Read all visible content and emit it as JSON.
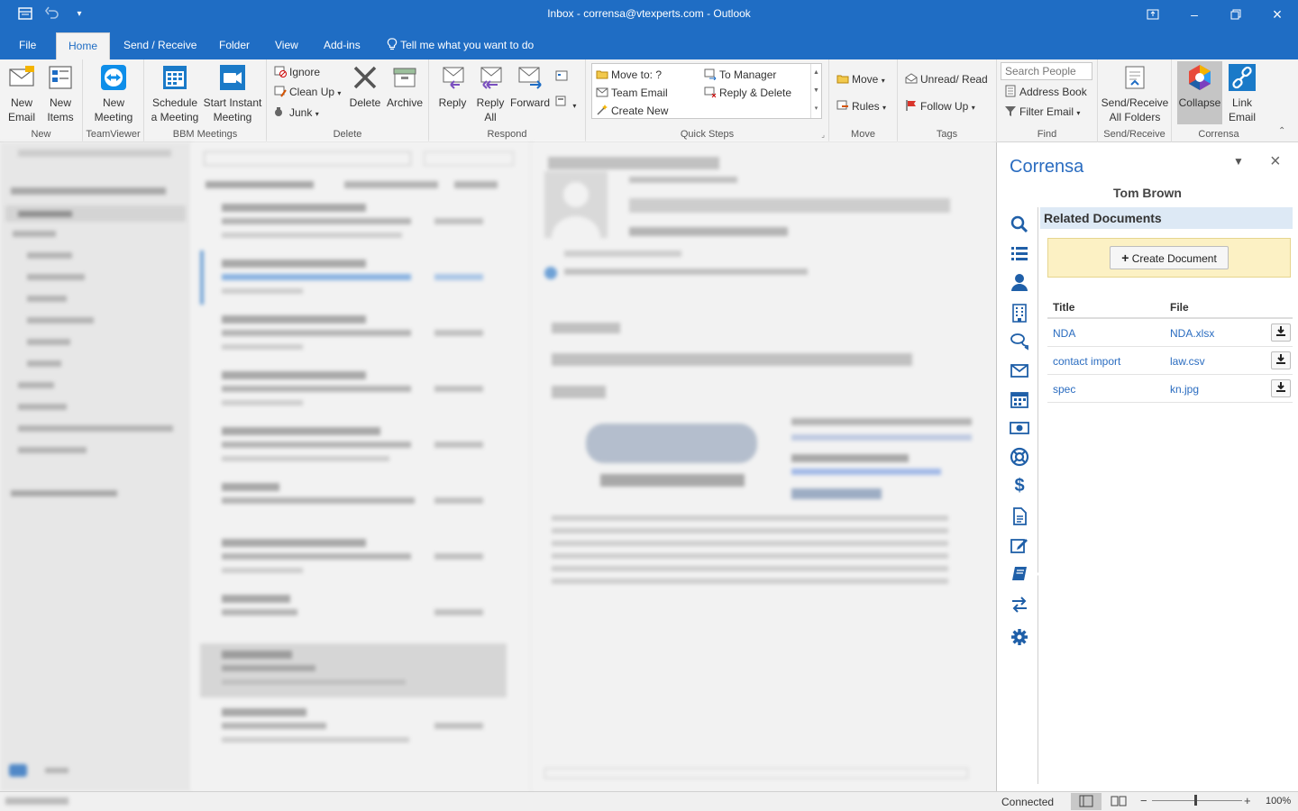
{
  "window": {
    "title": "Inbox - corrensa@vtexperts.com - Outlook",
    "colors": {
      "accent": "#1f6dc4",
      "corrensa_blue": "#2a6cc0",
      "create_bg": "#fcf1c4"
    }
  },
  "tabs": [
    {
      "label": "File"
    },
    {
      "label": "Home",
      "active": true
    },
    {
      "label": "Send / Receive"
    },
    {
      "label": "Folder"
    },
    {
      "label": "View"
    },
    {
      "label": "Add-ins"
    }
  ],
  "tell_me": "Tell me what you want to do",
  "ribbon": {
    "new_group": {
      "label": "New",
      "new_email": "New\nEmail",
      "new_items": "New\nItems"
    },
    "teamviewer": {
      "label": "TeamViewer",
      "new_meeting": "New\nMeeting"
    },
    "bbm": {
      "label": "BBM Meetings",
      "schedule": "Schedule\na Meeting",
      "instant": "Start Instant\nMeeting"
    },
    "delete": {
      "label": "Delete",
      "ignore": "Ignore",
      "clean_up": "Clean Up",
      "junk": "Junk",
      "delete": "Delete",
      "archive": "Archive"
    },
    "respond": {
      "label": "Respond",
      "reply": "Reply",
      "reply_all": "Reply\nAll",
      "forward": "Forward"
    },
    "quick_steps": {
      "label": "Quick Steps",
      "move_to": "Move to: ?",
      "team_email": "Team Email",
      "create_new": "Create New",
      "to_manager": "To Manager",
      "reply_delete": "Reply & Delete"
    },
    "move": {
      "label": "Move",
      "move": "Move",
      "rules": "Rules"
    },
    "tags": {
      "label": "Tags",
      "unread_read": "Unread/ Read",
      "follow_up": "Follow Up"
    },
    "find": {
      "label": "Find",
      "search_people": "Search People",
      "address_book": "Address Book",
      "filter_email": "Filter Email"
    },
    "send_receive": {
      "label": "Send/Receive",
      "all_folders": "Send/Receive\nAll Folders"
    },
    "corrensa": {
      "label": "Corrensa",
      "collapse": "Collapse",
      "link_email": "Link\nEmail"
    }
  },
  "corrensa": {
    "title": "Corrensa",
    "contact": "Tom Brown",
    "section": "Related Documents",
    "create_button": "Create Document",
    "columns": {
      "title": "Title",
      "file": "File"
    },
    "documents": [
      {
        "title": "NDA",
        "file": "NDA.xlsx"
      },
      {
        "title": "contact import",
        "file": "law.csv"
      },
      {
        "title": "spec",
        "file": "kn.jpg"
      }
    ]
  },
  "status": {
    "connection": "Connected",
    "zoom": "100%"
  }
}
